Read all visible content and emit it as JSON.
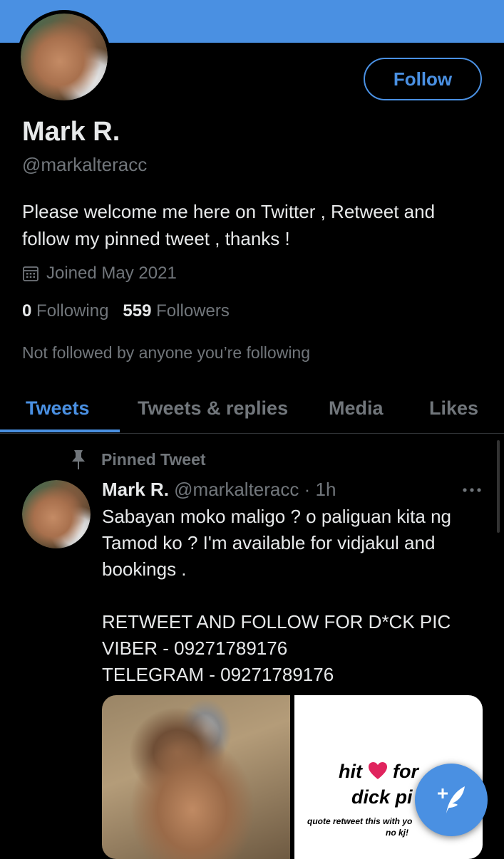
{
  "profile": {
    "name": "Mark R.",
    "handle": "@markalteracc",
    "bio": "Please welcome me here on Twitter , Retweet and follow my pinned tweet , thanks !",
    "joined": "Joined May 2021",
    "following_count": "0",
    "following_label": "Following",
    "followers_count": "559",
    "followers_label": "Followers",
    "not_followed": "Not followed by anyone you’re following",
    "follow_label": "Follow"
  },
  "tabs": [
    {
      "label": "Tweets",
      "active": true
    },
    {
      "label": "Tweets & replies",
      "active": false
    },
    {
      "label": "Media",
      "active": false
    },
    {
      "label": "Likes",
      "active": false
    }
  ],
  "tweet": {
    "pinned_label": "Pinned Tweet",
    "author_name": "Mark R.",
    "author_handle": "@markalteracc",
    "time": " · 1h",
    "text": "Sabayan moko maligo ? o paliguan kita ng Tamod ko ? I'm available for vidjakul and bookings .\n\nRETWEET AND FOLLOW FOR D*CK PIC\nVIBER - 09271789176\nTELEGRAM - 09271789176",
    "media_text": {
      "hit": "hit",
      "for": "for",
      "dick_pic": "dick pi",
      "quote": "quote retweet this with yo",
      "no_kj": "no kj!"
    }
  },
  "colors": {
    "accent": "#4a90e2",
    "background": "#000000",
    "text": "#e7e9ea",
    "muted": "#71767b"
  },
  "icons": {
    "calendar": "calendar-icon",
    "pin": "pin-icon",
    "more": "more-icon",
    "compose": "compose-tweet-icon",
    "heart": "heart-icon"
  }
}
